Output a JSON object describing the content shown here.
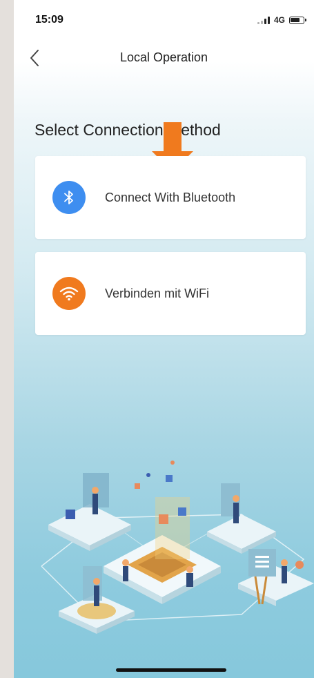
{
  "status_bar": {
    "time": "15:09",
    "network": "4G"
  },
  "nav": {
    "title": "Local Operation",
    "back_icon": "chevron-left-icon"
  },
  "section": {
    "title": "Select Connection Method"
  },
  "options": [
    {
      "label": "Connect With Bluetooth",
      "icon": "bluetooth-icon",
      "icon_color": "#3e8ef0"
    },
    {
      "label": "Verbinden mit WiFi",
      "icon": "wifi-icon",
      "icon_color": "#f07a1e"
    }
  ],
  "annotation": {
    "icon": "arrow-down-icon",
    "color": "#f07a1e"
  },
  "colors": {
    "accent_blue": "#3e8ef0",
    "accent_orange": "#f07a1e",
    "background_bottom": "#86c8dc"
  }
}
